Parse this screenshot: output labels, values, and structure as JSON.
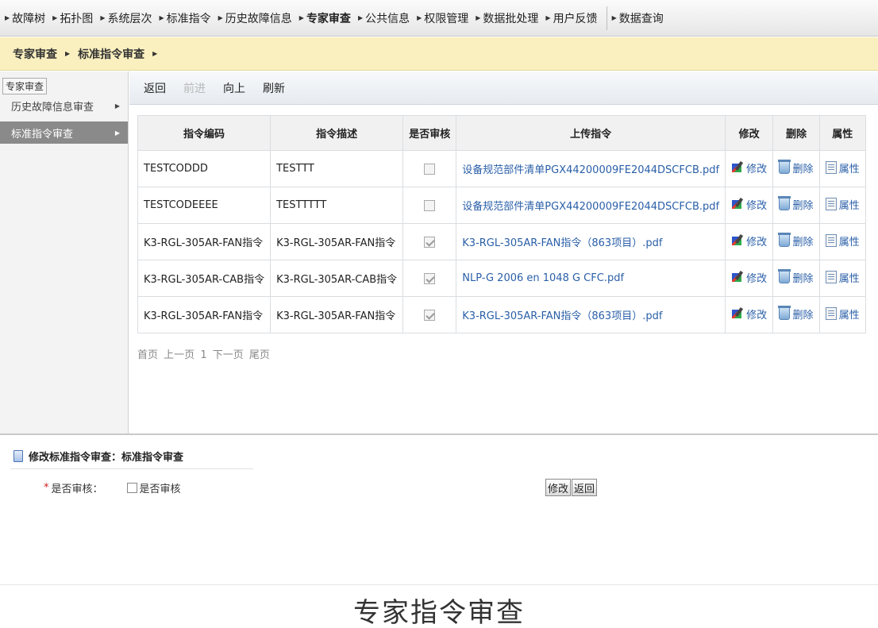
{
  "topnav": {
    "items": [
      {
        "label": "故障树",
        "active": false
      },
      {
        "label": "拓扑图",
        "active": false
      },
      {
        "label": "系统层次",
        "active": false
      },
      {
        "label": "标准指令",
        "active": false
      },
      {
        "label": "历史故障信息",
        "active": false
      },
      {
        "label": "专家审查",
        "active": true
      },
      {
        "label": "公共信息",
        "active": false
      },
      {
        "label": "权限管理",
        "active": false
      },
      {
        "label": "数据批处理",
        "active": false
      },
      {
        "label": "用户反馈",
        "active": false
      }
    ],
    "extra_item": "数据查询"
  },
  "breadcrumb": {
    "level1": "专家审查",
    "level2": "标准指令审查"
  },
  "sidebar": {
    "title": "专家审查",
    "items": [
      {
        "label": "历史故障信息审查",
        "selected": false
      },
      {
        "label": "标准指令审查",
        "selected": true
      }
    ]
  },
  "toolbar": {
    "back": "返回",
    "forward": "前进",
    "up": "向上",
    "refresh": "刷新"
  },
  "table": {
    "headers": [
      "指令编码",
      "指令描述",
      "是否审核",
      "上传指令",
      "修改",
      "删除",
      "属性"
    ],
    "action_labels": {
      "edit": "修改",
      "delete": "删除",
      "props": "属性"
    },
    "rows": [
      {
        "code": "TESTCODDD",
        "desc": "TESTTT",
        "reviewed": false,
        "file": "设备规范部件清单PGX44200009FE2044DSCFCB.pdf"
      },
      {
        "code": "TESTCODEEEE",
        "desc": "TESTTTTT",
        "reviewed": false,
        "file": "设备规范部件清单PGX44200009FE2044DSCFCB.pdf"
      },
      {
        "code": "K3-RGL-305AR-FAN指令",
        "desc": "K3-RGL-305AR-FAN指令",
        "reviewed": true,
        "file": "K3-RGL-305AR-FAN指令（863项目）.pdf"
      },
      {
        "code": "K3-RGL-305AR-CAB指令",
        "desc": "K3-RGL-305AR-CAB指令",
        "reviewed": true,
        "file": "NLP-G 2006 en 1048 G CFC.pdf"
      },
      {
        "code": "K3-RGL-305AR-FAN指令",
        "desc": "K3-RGL-305AR-FAN指令",
        "reviewed": true,
        "file": "K3-RGL-305AR-FAN指令（863项目）.pdf"
      }
    ]
  },
  "pager": {
    "first": "首页",
    "prev": "上一页",
    "current": "1",
    "next": "下一页",
    "last": "尾页"
  },
  "form": {
    "title": "修改标准指令审查：标准指令审查",
    "required_mark": "*",
    "field_label": "是否审核：",
    "checkbox_label": "是否审核",
    "save_button": "修改",
    "back_button": "返回"
  },
  "caption": "专家指令审查"
}
